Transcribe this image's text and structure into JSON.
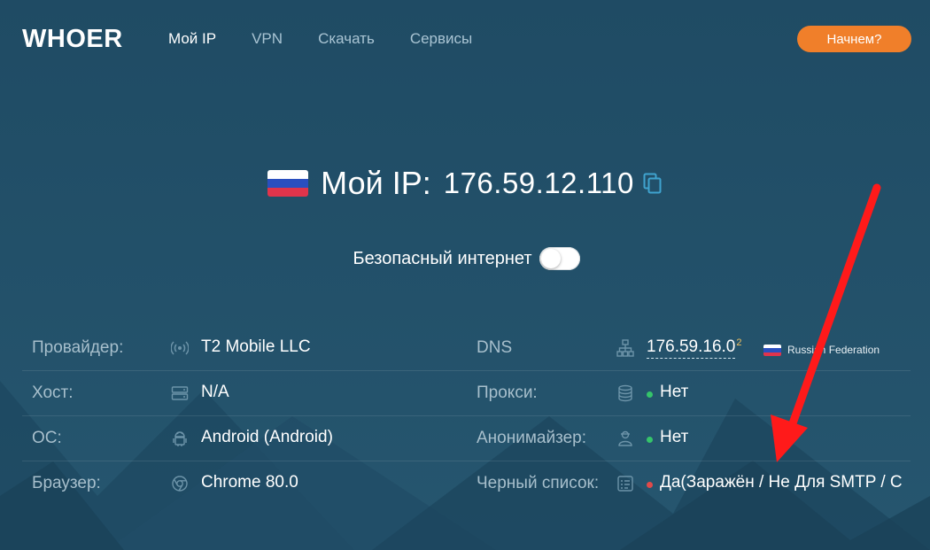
{
  "header": {
    "logo": "WHOER",
    "nav": [
      "Мой IP",
      "VPN",
      "Скачать",
      "Сервисы"
    ],
    "cta": "Начнем?"
  },
  "ip": {
    "label": "Мой IP:",
    "value": "176.59.12.110",
    "flag": "russia-flag"
  },
  "safe_internet": {
    "label": "Безопасный интернет",
    "enabled": false
  },
  "info": {
    "provider": {
      "label": "Провайдер:",
      "value": "T2 Mobile LLC",
      "icon": "signal-icon"
    },
    "host": {
      "label": "Хост:",
      "value": "N/A",
      "icon": "server-icon"
    },
    "os": {
      "label": "ОС:",
      "value": "Android (Android)",
      "icon": "android-icon"
    },
    "browser": {
      "label": "Браузер:",
      "value": "Chrome 80.0",
      "icon": "chrome-icon"
    },
    "dns": {
      "label": "DNS",
      "value": "176.59.16.0",
      "sup": "2",
      "country": "Russian Federation",
      "icon": "network-icon"
    },
    "proxy": {
      "label": "Прокси:",
      "value": "Нет",
      "icon": "database-icon",
      "status_color": "#35c46a"
    },
    "anonymizer": {
      "label": "Анонимайзер:",
      "value": "Нет",
      "icon": "person-icon",
      "status_color": "#35c46a"
    },
    "blacklist": {
      "label": "Черный список:",
      "value": "Да(Заражён / Не Для SMTP / С",
      "icon": "list-icon",
      "status_color": "#e04a4a"
    }
  },
  "colors": {
    "background": "#22506a",
    "accent": "#f07f2a",
    "annotation_arrow": "#ff1a1a"
  }
}
